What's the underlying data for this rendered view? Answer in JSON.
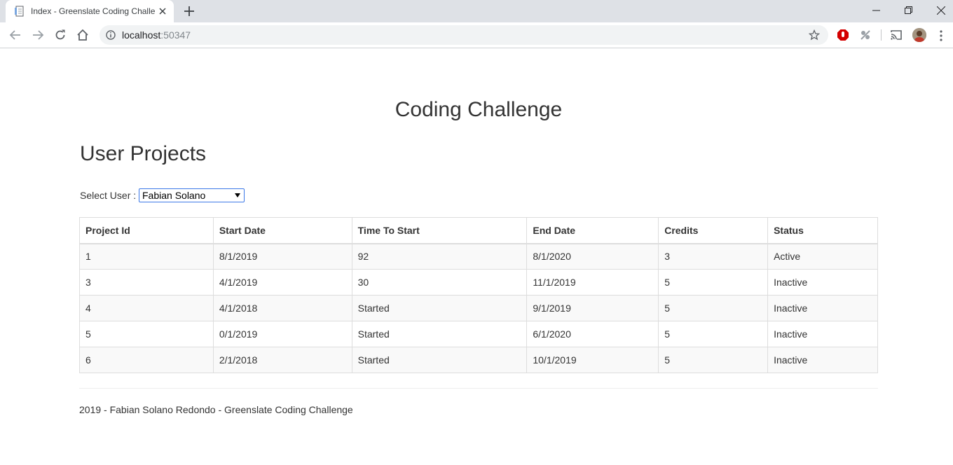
{
  "browser": {
    "tab_title": "Index - Greenslate Coding Challe",
    "url_host": "localhost",
    "url_port": ":50347"
  },
  "page": {
    "title": "Coding Challenge",
    "section_title": "User Projects",
    "select_label": "Select User :",
    "selected_user": "Fabian Solano"
  },
  "table": {
    "headers": [
      "Project Id",
      "Start Date",
      "Time To Start",
      "End Date",
      "Credits",
      "Status"
    ],
    "rows": [
      [
        "1",
        "8/1/2019",
        "92",
        "8/1/2020",
        "3",
        "Active"
      ],
      [
        "3",
        "4/1/2019",
        "30",
        "11/1/2019",
        "5",
        "Inactive"
      ],
      [
        "4",
        "4/1/2018",
        "Started",
        "9/1/2019",
        "5",
        "Inactive"
      ],
      [
        "5",
        "0/1/2019",
        "Started",
        "6/1/2020",
        "5",
        "Inactive"
      ],
      [
        "6",
        "2/1/2018",
        "Started",
        "10/1/2019",
        "5",
        "Inactive"
      ]
    ]
  },
  "footer": {
    "text": "2019 - Fabian Solano Redondo - Greenslate Coding Challenge"
  },
  "icons": {
    "tab_favicon": "page-icon",
    "tab_close": "close-icon",
    "new_tab": "plus-icon",
    "back": "back-arrow-icon",
    "forward": "forward-arrow-icon",
    "reload": "reload-icon",
    "home": "home-icon",
    "site_info": "info-icon",
    "bookmark": "star-icon",
    "extension_1": "adblock-icon",
    "extension_2": "puzzle-icon",
    "cast": "cast-icon",
    "menu": "kebab-menu-icon"
  }
}
